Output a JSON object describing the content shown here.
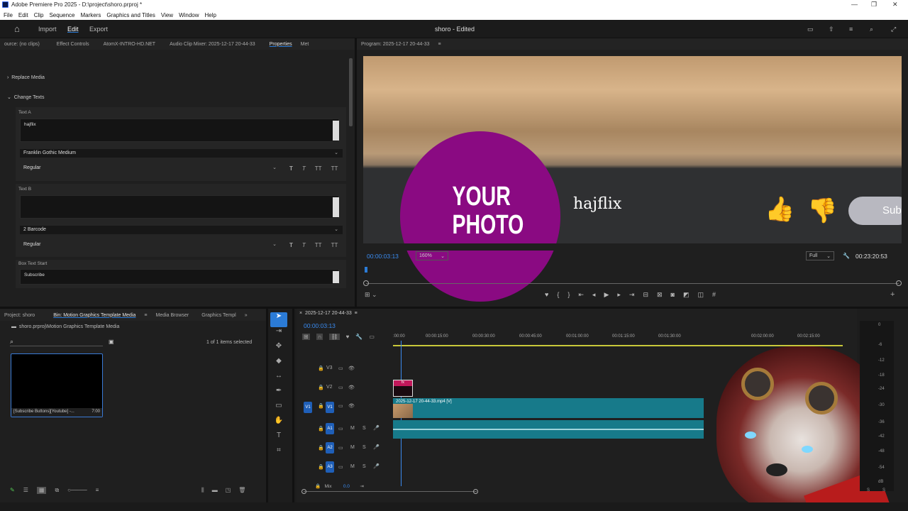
{
  "window": {
    "title": "Adobe Premiere Pro 2025 - D:\\project\\shoro.prproj *",
    "min": "—",
    "max": "❐",
    "close": "✕"
  },
  "menu": [
    "File",
    "Edit",
    "Clip",
    "Sequence",
    "Markers",
    "Graphics and Titles",
    "View",
    "Window",
    "Help"
  ],
  "appbar": {
    "import": "Import",
    "edit": "Edit",
    "export": "Export",
    "project_title": "shoro - Edited"
  },
  "left_tabs": [
    "ource: (no clips)",
    "Effect Controls",
    "AtomX-INTRO-HD.NET",
    "Audio Clip Mixer: 2025-12-17 20-44-33",
    "Properties",
    "Met"
  ],
  "properties": {
    "replace_media": "Replace Media",
    "change_texts": "Change Texts",
    "text_a": {
      "label": "Text A",
      "value": "hajflix",
      "font": "Franklin Gothic Medium",
      "style": "Regular"
    },
    "text_b": {
      "label": "Text B",
      "value": "",
      "font": "2 Barcode",
      "style": "Regular"
    },
    "box_text": {
      "label": "Box Text Start",
      "value": "Subscribe"
    },
    "fmt": [
      "T",
      "T",
      "TT",
      "TT"
    ]
  },
  "program": {
    "tab": "Program: 2025-12-17 20-44-33",
    "timecode": "00:00:03:13",
    "zoom": "160%",
    "quality": "Full",
    "duration": "00:23:20:53"
  },
  "overlay": {
    "photo_line1": "YOUR",
    "photo_line2": "PHOTO",
    "name": "hajflix",
    "sub": "Sub"
  },
  "bin": {
    "tabs": [
      "Project: shoro",
      "Bin: Motion Graphics Template Media",
      "Media Browser",
      "Graphics Templ"
    ],
    "path": "shoro.prproj\\Motion Graphics Template Media",
    "selected": "1 of 1 items selected",
    "item_name": "[Subscribe Buttons][Youtube] -...",
    "item_dur": "7:00"
  },
  "timeline": {
    "tab": "2025-12-17 20-44-33",
    "timecode": "00:00:03:13",
    "ruler": [
      ":00:00",
      "00:00:15:00",
      "00:00:30:00",
      "00:00:45:00",
      "00:01:00:00",
      "00:01:15:00",
      "00:01:30:00",
      "00:02:00:00",
      "00:02:15:00"
    ],
    "tracks": [
      "V3",
      "V2",
      "V1",
      "A1",
      "A2",
      "A3"
    ],
    "clip_label": "2025-12-17 20-44-33.mp4 [V]",
    "fx": "fx",
    "mix": "Mix",
    "mix_val": "0.0",
    "m": "M",
    "s": "S"
  },
  "meter": {
    "labels": [
      "0",
      "-6",
      "-12",
      "-18",
      "-24",
      "-30",
      "-36",
      "-42",
      "-48",
      "-54",
      "dB"
    ],
    "s": "S",
    "s2": "S"
  },
  "colors": {
    "accent": "#2b7bd6",
    "purple": "#8a0a82",
    "clip": "#177a8a"
  }
}
